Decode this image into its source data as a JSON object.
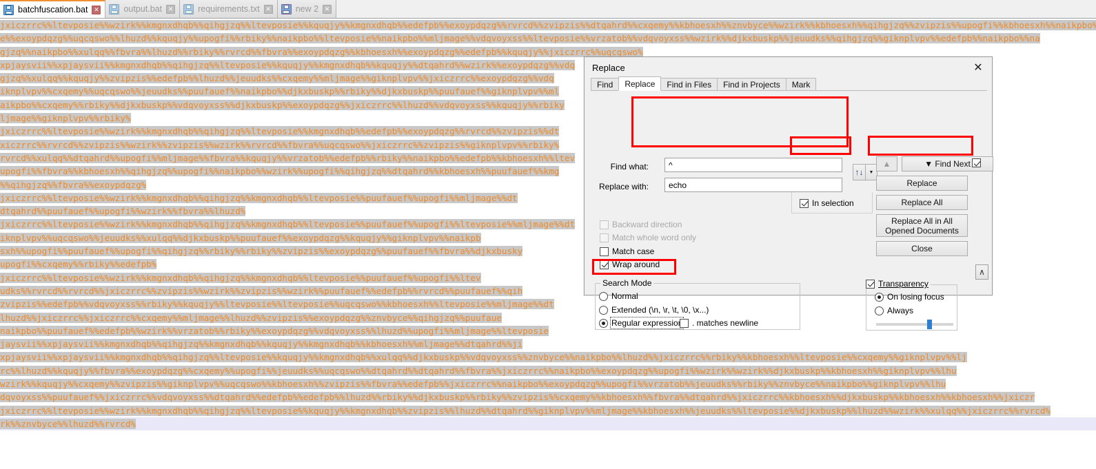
{
  "tabs": [
    {
      "label": "batchfuscation.bat",
      "active": true,
      "icon": "floppy-disk-icon",
      "close": "✕"
    },
    {
      "label": "output.bat",
      "active": false,
      "icon": "floppy-disk-icon",
      "close": "✕"
    },
    {
      "label": "requirements.txt",
      "active": false,
      "icon": "floppy-disk-icon",
      "close": "✕"
    },
    {
      "label": "new 2",
      "active": false,
      "icon": "floppy-disk-icon",
      "close": "✕"
    }
  ],
  "editor": {
    "text_color": "#ef8a28",
    "selection_color": "#c8c8c8",
    "current_line_color": "#e8e8f8",
    "lines": [
      {
        "sel": "jxiczrrc%%ltevposie%%wzirk%%kmgnxdhqb%%qihgjzq%%ltevposie%%kquqjy%%kmgnxdhqb%%edefpb%%exoypdqzg%%rvrcd%%zvipzis%%dtqahrd%%cxqemy%%kbhoesxh%%znvbyce%%wzirk%%kbhoesxh%%qihgjzq%%zvipzis%%upogfi%%kbhoesxh%%naikpbo%%na",
        "tail": ""
      },
      {
        "sel": "e%%exoypdqzg%%uqcqswo%%lhuzd%%kquqjy%%upogfi%%rbiky%%naikpbo%%ltevposie%%naikpbo%%mljmage%%vdqvoyxss%%ltevposie%%vrzatob%%vdqvoyxss%%wzirk%%djkxbuskp%%jeuudks%%qihgjzq%%giknplvpv%%edefpb%%naikpbo%%na",
        "tail": ""
      },
      {
        "sel": "gjzq%%naikpbo%%xulqq%%fbvra%%lhuzd%%rbiky%%rvrcd%%fbvra%%exoypdqzg%%kbhoesxh%%exoypdqzg%%edefpb%%kquqjy%%jxiczrrc%%uqcqswo%",
        "tail": ""
      },
      {
        "sel": "xpjaysvii%%xpjaysvii%%kmgnxdhqb%%qihgjzq%%ltevposie%%kquqjy%%kmgnxdhqb%%kquqjy%%dtqahrd%%wzirk%%exoypdqzg%%vdq",
        "tail": ""
      },
      {
        "sel": "gjzq%%xulqq%%kquqjy%%zvipzis%%edefpb%%lhuzd%%jeuudks%%cxqemy%%mljmage%%giknplvpv%%jxiczrrc%%exoypdqzg%%vdq",
        "tail": ""
      },
      {
        "sel": "iknplvpv%%cxqemy%%uqcqswo%%jeuudks%%puufauef%%naikpbo%%djkxbuskp%%rbiky%%djkxbuskp%%puufauef%%giknplvpv%%ml",
        "tail": ""
      },
      {
        "sel": "aikpbo%%cxqemy%%rbiky%%djkxbuskp%%vdqvoyxss%%djkxbuskp%%exoypdqzg%%jxiczrrc%%lhuzd%%vdqvoyxss%%kquqjy%%rbiky",
        "tail": ""
      },
      {
        "sel": "ljmage%%giknplvpv%%rbiky%",
        "tail": ""
      },
      {
        "sel": "jxiczrrc%%ltevposie%%wzirk%%kmgnxdhqb%%qihgjzq%%ltevposie%%kmgnxdhqb%%edefpb%%exoypdqzg%%rvrcd%%zvipzis%%dt",
        "tail": ""
      },
      {
        "sel": "xiczrrc%%rvrcd%%zvipzis%%wzirk%%zvipzis%%wzirk%%rvrcd%%fbvra%%uqcqswo%%jxiczrrc%%zvipzis%%giknplvpv%%rbiky%",
        "tail": ""
      },
      {
        "sel": "rvrcd%%xulqq%%dtqahrd%%upogfi%%mljmage%%fbvra%%kquqjy%%vrzatob%%edefpb%%rbiky%%naikpbo%%edefpb%%kbhoesxh%%ltev",
        "tail": ""
      },
      {
        "sel": "upogfi%%fbvra%%kbhoesxh%%qihgjzq%%upogfi%%naikpbo%%wzirk%%upogfi%%qihgjzq%%dtqahrd%%kbhoesxh%%puufauef%%kmg",
        "tail": ""
      },
      {
        "sel": "%%qihgjzq%%fbvra%%exoypdqzg%",
        "tail": ""
      },
      {
        "sel": "jxiczrrc%%ltevposie%%wzirk%%kmgnxdhqb%%qihgjzq%%kmgnxdhqb%%ltevposie%%puufauef%%upogfi%%mljmage%%dt",
        "tail": ""
      },
      {
        "sel": "dtqahrd%%puufauef%%upogfi%%wzirk%%fbvra%%lhuzd%",
        "tail": ""
      },
      {
        "sel": "jxiczrrc%%ltevposie%%wzirk%%kmgnxdhqb%%qihgjzq%%kmgnxdhqb%%ltevposie%%puufauef%%upogfi%%ltevposie%%mljmage%%dt",
        "tail": ""
      },
      {
        "sel": "iknplvpv%%uqcqswo%%jeuudks%%xulqq%%djkxbuskp%%puufauef%%exoypdqzg%%kquqjy%%giknplvpv%%naikpb",
        "tail": ""
      },
      {
        "sel": "sxh%%upogfi%%puufauef%%upogfi%%qihgjzq%%rbiky%%rbiky%%zvipzis%%exoypdqzg%%puufauef%%fbvra%%djkxbusky",
        "tail": ""
      },
      {
        "sel": "upogfi%%cxqemy%%rbiky%%edefpb%",
        "tail": ""
      },
      {
        "sel": "jxiczrrc%%ltevposie%%wzirk%%kmgnxdhqb%%qihgjzq%%kmgnxdhqb%%ltevposie%%puufauef%%upogfi%%ltev",
        "tail": ""
      },
      {
        "sel": "udks%%rvrcd%%rvrcd%%jxiczrrc%%zvipzis%%wzirk%%zvipzis%%wzirk%%puufauef%%edefpb%%rvrcd%%puufauef%%qih",
        "tail": ""
      },
      {
        "sel": "zvipzis%%edefpb%%vdqvoyxss%%rbiky%%kquqjy%%ltevposie%%ltevposie%%uqcqswo%%kbhoesxh%%ltevposie%%mljmage%%dt",
        "tail": ""
      },
      {
        "sel": "lhuzd%%jxiczrrc%%jxiczrrc%%cxqemy%%mljmage%%lhuzd%%zvipzis%%exoypdqzg%%znvbyce%%qihgjzq%%puufaue",
        "tail": ""
      },
      {
        "sel": "naikpbo%%puufauef%%edefpb%%wzirk%%vrzatob%%rbiky%%exoypdqzg%%vdqvoyxss%%lhuzd%%upogfi%%mljmage%%ltevposie",
        "tail": ""
      },
      {
        "sel": "jaysvii%%xpjaysvii%%kmgnxdhqb%%qihgjzq%%kmgnxdhqb%%kquqjy%%kmgnxdhqb%%kbhoesxh%%mljmage%%dtqahrd%%ji",
        "tail": ""
      },
      {
        "sel": "xpjaysvii%%xpjaysvii%%kmgnxdhqb%%qihgjzq%%ltevposie%%kquqjy%%kmgnxdhqb%%xulqq%%djkxbuskp%%vdqvoyxss%%znvbyce%%naikpbo%%lhuzd%%jxiczrrc%%rbiky%%kbhoesxh%%ltevposie%%cxqemy%%giknplvpv%%lj",
        "tail": ""
      },
      {
        "sel": "rc%%lhuzd%%kquqjy%%fbvra%%exoypdqzg%%cxqemy%%upogfi%%jeuudks%%uqcqswo%%dtqahrd%%dtqahrd%%fbvra%%jxiczrrc%%naikpbo%%exoypdqzg%%upogfi%%wzirk%%wzirk%%djkxbuskp%%kbhoesxh%%giknplvpv%%lhu",
        "tail": ""
      },
      {
        "sel": "wzirk%%kquqjy%%cxqemy%%zvipzis%%giknplvpv%%uqcqswo%%kbhoesxh%%zvipzis%%fbvra%%edefpb%%jxiczrrc%%naikpbo%%exoypdqzg%%upogfi%%vrzatob%%jeuudks%%rbiky%%znvbyce%%naikpbo%%giknplvpv%%lhu",
        "tail": ""
      },
      {
        "sel": "dqvoyxss%%puufauef%%jxiczrrc%%vdqvoyxss%%dtqahrd%%edefpb%%edefpb%%lhuzd%%rbiky%%djkxbuskp%%rbiky%%zvipzis%%cxqemy%%kbhoesxh%%fbvra%%dtqahrd%%jxiczrrc%%kbhoesxh%%djkxbuskp%%kbhoesxh%%kbhoesxh%%jxiczr",
        "tail": ""
      },
      {
        "sel": "jxiczrrc%%ltevposie%%wzirk%%kmgnxdhqb%%qihgjzq%%ltevposie%%kquqjy%%kmgnxdhqb%%zvipzis%%lhuzd%%dtqahrd%%giknplvpv%%mljmage%%kbhoesxh%%jeuudks%%ltevposie%%djkxbuskp%%lhuzd%%wzirk%%xulqq%%jxiczrrc%%rvrcd%",
        "tail": ""
      },
      {
        "sel": "rk%%znvbyce%%lhuzd%%rvrcd%",
        "tail": "",
        "current": true
      }
    ]
  },
  "dialog": {
    "title": "Replace",
    "close_label": "✕",
    "tabs": [
      {
        "label": "Find",
        "selected": false
      },
      {
        "label": "Replace",
        "selected": true
      },
      {
        "label": "Find in Files",
        "selected": false
      },
      {
        "label": "Find in Projects",
        "selected": false
      },
      {
        "label": "Mark",
        "selected": false
      }
    ],
    "find_label": "Find what:",
    "find_value": "^",
    "replace_label": "Replace with:",
    "replace_value": "echo",
    "swap_icon": "↑↓",
    "swap_dropdown_icon": "▼",
    "buttons": {
      "find_next": "▼ Find Next",
      "replace": "Replace",
      "replace_all": "Replace All",
      "replace_all_opened": "Replace All in All Opened Documents",
      "close": "Close",
      "up_arrow": "▲"
    },
    "in_selection": {
      "label": "In selection",
      "checked": true
    },
    "find_next_toggle_checked": true,
    "options": [
      {
        "label": "Backward direction",
        "checked": false,
        "disabled": true
      },
      {
        "label": "Match whole word only",
        "checked": false,
        "disabled": true
      },
      {
        "label": "Match case",
        "checked": false,
        "disabled": false
      },
      {
        "label": "Wrap around",
        "checked": true,
        "disabled": false
      }
    ],
    "search_mode": {
      "title": "Search Mode",
      "options": [
        {
          "label": "Normal",
          "selected": false
        },
        {
          "label": "Extended (\\n, \\r, \\t, \\0, \\x...)",
          "selected": false
        },
        {
          "label": "Regular expression",
          "selected": true
        }
      ],
      "dot_matches_newline": {
        "label": ". matches newline",
        "checked": false
      }
    },
    "transparency": {
      "title": "Transparency",
      "checked": true,
      "options": [
        {
          "label": "On losing focus",
          "selected": true
        },
        {
          "label": "Always",
          "selected": false
        }
      ],
      "slider_percent": 66
    },
    "corner_button_icon": "∧"
  },
  "annotations": {
    "highlight_color": "#ff0000",
    "boxes": [
      "find-replace-fields",
      "in-selection-checkbox",
      "replace-all-button",
      "regular-expression-radio"
    ]
  }
}
